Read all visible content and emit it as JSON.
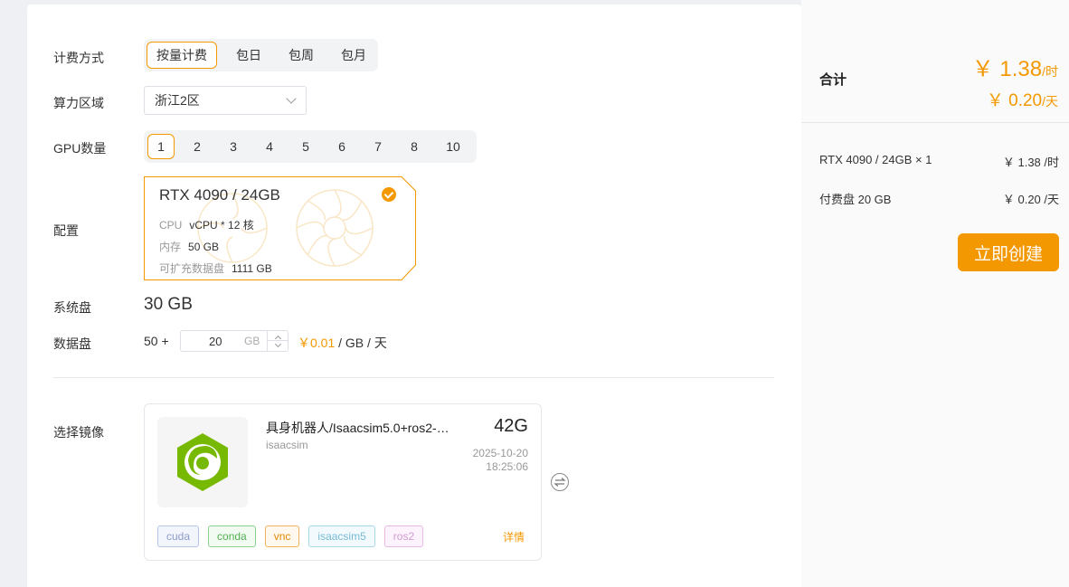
{
  "form": {
    "billing": {
      "label": "计费方式",
      "options": [
        "按量计费",
        "包日",
        "包周",
        "包月"
      ],
      "selected": "按量计费"
    },
    "region": {
      "label": "算力区域",
      "value": "浙江2区"
    },
    "gpu_count": {
      "label": "GPU数量",
      "options": [
        "1",
        "2",
        "3",
        "4",
        "5",
        "6",
        "7",
        "8",
        "10"
      ],
      "selected": "1"
    },
    "config": {
      "label": "配置",
      "title": "RTX 4090 / 24GB",
      "cpu_key": "CPU",
      "cpu_val": "vCPU * 12 核",
      "mem_key": "内存",
      "mem_val": "50 GB",
      "disk_key": "可扩充数据盘",
      "disk_val": "1111 GB"
    },
    "system_disk": {
      "label": "系统盘",
      "value": "30 GB"
    },
    "data_disk": {
      "label": "数据盘",
      "prefix": "50 +",
      "value": "20",
      "unit": "GB",
      "price_highlight": "￥0.01",
      "price_rest": " / GB / 天"
    },
    "image": {
      "label": "选择镜像",
      "name": "具身机器人/Isaacsim5.0+ros2-…",
      "subtitle": "isaacsim",
      "size": "42G",
      "date": "2025-10-20",
      "time": "18:25:06",
      "tags": [
        "cuda",
        "conda",
        "vnc",
        "isaacsim5",
        "ros2"
      ],
      "detail": "详情"
    }
  },
  "summary": {
    "total_label": "合计",
    "total_hour_amount": "￥ 1.38",
    "total_hour_unit": "/时",
    "total_day_amount": "￥ 0.20",
    "total_day_unit": "/天",
    "items": [
      {
        "name": "RTX 4090 / 24GB × 1",
        "price": "￥ 1.38 /时"
      },
      {
        "name": "付费盘 20 GB",
        "price": "￥ 0.20 /天"
      }
    ],
    "create_button": "立即创建"
  },
  "colors": {
    "accent": "#f39800",
    "page_bg": "#eef0f4"
  }
}
